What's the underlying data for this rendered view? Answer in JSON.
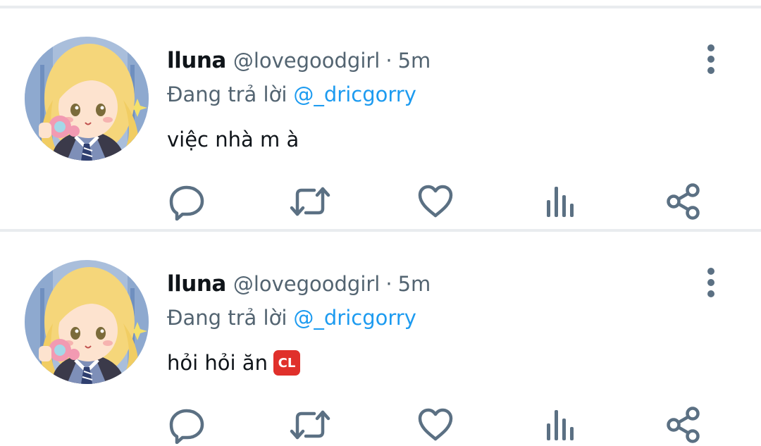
{
  "colors": {
    "text_primary": "#0f1419",
    "text_secondary": "#536471",
    "link": "#1d9bf0",
    "icon": "#5b7083",
    "divider": "#e9ecef"
  },
  "tweets": [
    {
      "display_name": "lluna",
      "handle": "@lovegoodgirl",
      "separator": "·",
      "time": "5m",
      "reply_prefix": "Đang trả lời",
      "reply_target": "@_dricgorry",
      "text": "việc nhà m à",
      "emoji": "",
      "icons": [
        "reply-icon",
        "retweet-icon",
        "like-icon",
        "views-icon",
        "share-icon",
        "more-options-icon"
      ]
    },
    {
      "display_name": "lluna",
      "handle": "@lovegoodgirl",
      "separator": "·",
      "time": "5m",
      "reply_prefix": "Đang trả lời",
      "reply_target": "@_dricgorry",
      "text": "hỏi hỏi ăn",
      "emoji": "CL",
      "icons": [
        "reply-icon",
        "retweet-icon",
        "like-icon",
        "views-icon",
        "share-icon",
        "more-options-icon"
      ]
    }
  ]
}
